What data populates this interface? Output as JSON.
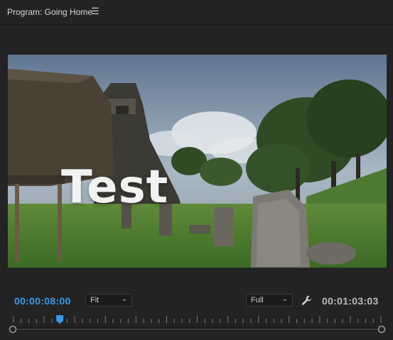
{
  "panel": {
    "title": "Program: Going Home",
    "menu_icon": "hamburger-menu-icon"
  },
  "viewer": {
    "overlay_text": "Test"
  },
  "controls": {
    "current_timecode": "00:00:08:00",
    "zoom_select": {
      "value": "Fit",
      "icon": "chevron-down-icon"
    },
    "resolution_select": {
      "value": "Full",
      "icon": "chevron-down-icon"
    },
    "settings_icon": "wrench-icon",
    "duration_timecode": "00:01:03:03"
  },
  "colors": {
    "background": "#232323",
    "timecode_accent": "#3b9ae6",
    "playhead": "#3b9ae6"
  },
  "timeline": {
    "playhead_fraction": 0.126
  }
}
